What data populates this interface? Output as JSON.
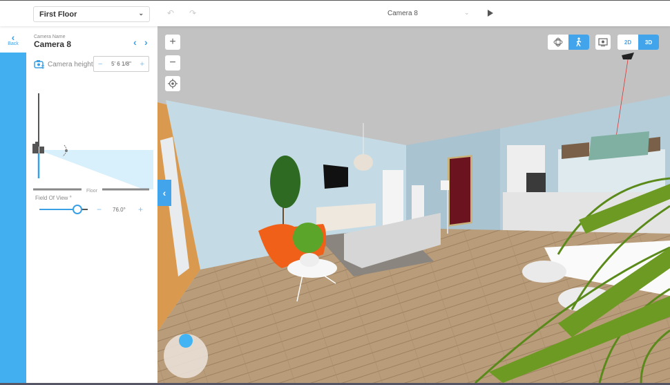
{
  "topbar": {
    "floor_selector": {
      "selected": "First Floor",
      "chevron_icon": "chevron-down-icon"
    },
    "undo_icon": "undo-icon",
    "redo_icon": "redo-icon",
    "camera_selector": {
      "selected": "Camera 8",
      "chevron_icon": "chevron-down-icon"
    },
    "play_icon": "play-icon"
  },
  "sidebar": {
    "back": {
      "arrow": "‹",
      "label": "Back"
    }
  },
  "camera_panel": {
    "name_label": "Camera Name",
    "name": "Camera 8",
    "prev": "‹",
    "next": "›",
    "height": {
      "label": "Camera height",
      "value": "5' 6 1/8\"",
      "minus": "−",
      "plus": "+"
    },
    "diagram": {
      "floor_label": "Floor"
    },
    "field_of_view": {
      "label": "Field Of View °",
      "value": "76.0°",
      "slider_fraction": 0.78,
      "minus": "−",
      "plus": "+"
    }
  },
  "viewport": {
    "zoom_in": "+",
    "zoom_out": "−",
    "locate_icon": "crosshair-icon",
    "collapse_panel": "‹",
    "view_modes": [
      {
        "name": "orbit",
        "icon": "orbit-icon",
        "active": false
      },
      {
        "name": "walk",
        "icon": "walk-icon",
        "active": true
      }
    ],
    "capture_icon": "capture-icon",
    "dimension_modes": [
      {
        "label": "2D",
        "active": false
      },
      {
        "label": "3D",
        "active": true
      }
    ],
    "colors": {
      "accent": "#42a5ec",
      "ceiling": "#c2c2c2",
      "wall": "#c4dbe6",
      "floor": "#b59a78",
      "armchair": "#f06018",
      "door": "#6b1420"
    }
  }
}
